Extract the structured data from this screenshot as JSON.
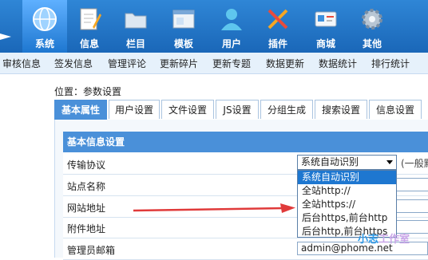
{
  "topnav": {
    "items": [
      {
        "label": "系统",
        "icon": "globe-icon",
        "active": true
      },
      {
        "label": "信息",
        "icon": "document-pen-icon"
      },
      {
        "label": "栏目",
        "icon": "folder-icon"
      },
      {
        "label": "模板",
        "icon": "template-window-icon"
      },
      {
        "label": "用户",
        "icon": "user-icon"
      },
      {
        "label": "插件",
        "icon": "tools-icon"
      },
      {
        "label": "商城",
        "icon": "card-icon"
      },
      {
        "label": "其他",
        "icon": "gear-icon"
      }
    ]
  },
  "subnav": {
    "items": [
      "审核信息",
      "签发信息",
      "管理评论",
      "更新碎片",
      "更新专题",
      "数据更新",
      "数据统计",
      "排行统计"
    ]
  },
  "location": "位置：参数设置",
  "tabs": [
    "基本属性",
    "用户设置",
    "文件设置",
    "JS设置",
    "分组生成",
    "搜索设置",
    "信息设置"
  ],
  "panel": {
    "title": "基本信息设置",
    "rows": [
      "传输协议",
      "站点名称",
      "网站地址",
      "附件地址",
      "管理员邮箱"
    ]
  },
  "protocol": {
    "selected": "系统自动识别",
    "hint": "(一般默",
    "options": [
      "系统自动识别",
      "全站http://",
      "全站https://",
      "后台https,前台http",
      "后台http,前台https"
    ]
  },
  "admin_email": "admin@phome.net",
  "watermark": {
    "part1": "小志",
    "part2": "工作室"
  },
  "colors": {
    "nav_bg": "#1a67b8",
    "accent": "#4a90d9",
    "arrow": "#e03a3a"
  }
}
